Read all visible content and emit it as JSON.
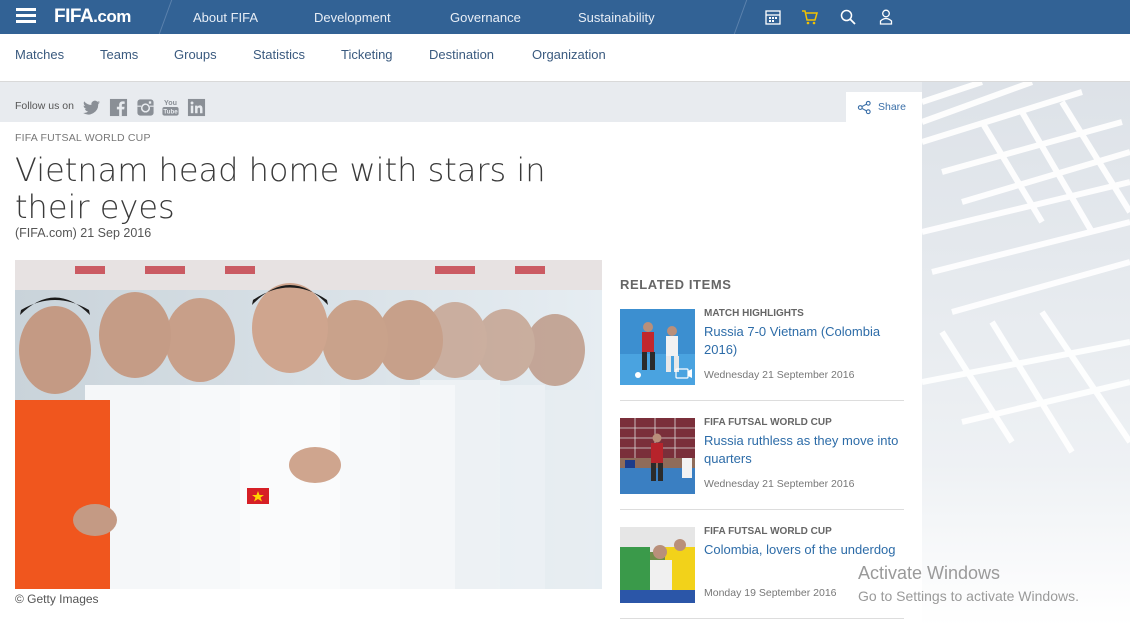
{
  "header": {
    "logo": "FIFA",
    "logo_suffix": ".com",
    "nav": [
      "About FIFA",
      "Development",
      "Governance",
      "Sustainability"
    ],
    "icons": [
      "calendar-icon",
      "cart-icon",
      "search-icon",
      "user-icon"
    ]
  },
  "subnav": [
    "Matches",
    "Teams",
    "Groups",
    "Statistics",
    "Ticketing",
    "Destination",
    "Organization"
  ],
  "social": {
    "label": "Follow us on",
    "icons": [
      "twitter-icon",
      "facebook-icon",
      "instagram-icon",
      "youtube-icon",
      "linkedin-icon"
    ],
    "youtube_text": "You\nTube",
    "share_label": "Share"
  },
  "article": {
    "kicker": "FIFA FUTSAL WORLD CUP",
    "headline": "Vietnam head home with stars in their eyes",
    "byline": "(FIFA.com) 21 Sep 2016",
    "image_caption": "© Getty Images"
  },
  "related": {
    "title": "RELATED ITEMS",
    "items": [
      {
        "category": "MATCH HIGHLIGHTS",
        "title": "Russia 7-0 Vietnam (Colombia 2016)",
        "date": "Wednesday 21 September 2016",
        "video": true
      },
      {
        "category": "FIFA FUTSAL WORLD CUP",
        "title": "Russia ruthless as they move into quarters",
        "date": "Wednesday 21 September 2016",
        "video": false
      },
      {
        "category": "FIFA FUTSAL WORLD CUP",
        "title": "Colombia, lovers of the underdog",
        "date": "Monday 19 September 2016",
        "video": false
      }
    ]
  },
  "watermark": {
    "line1": "Activate Windows",
    "line2": "Go to Settings to activate Windows."
  },
  "colors": {
    "topbar": "#326295",
    "link": "#2d6ca8",
    "gray_band": "#e8ebef"
  }
}
